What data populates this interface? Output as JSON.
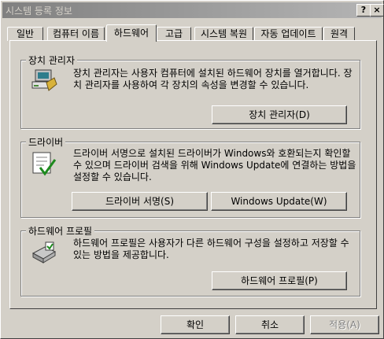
{
  "window": {
    "title": "시스템 등록 정보",
    "help_label": "?",
    "close_label": "×"
  },
  "tabs": [
    {
      "label": "일반"
    },
    {
      "label": "컴퓨터 이름"
    },
    {
      "label": "하드웨어"
    },
    {
      "label": "고급"
    },
    {
      "label": "시스템 복원"
    },
    {
      "label": "자동 업데이트"
    },
    {
      "label": "원격"
    }
  ],
  "active_tab": "하드웨어",
  "device_manager": {
    "title": "장치 관리자",
    "description": "장치 관리자는 사용자 컴퓨터에 설치된 하드웨어 장치를 열거합니다. 장치 관리자를 사용하여 각 장치의 속성을 변경할 수 있습니다.",
    "button_label": "장치 관리자(D)",
    "icon": "device-manager-icon"
  },
  "drivers": {
    "title": "드라이버",
    "description": "드라이버 서명으로 설치된 드라이버가 Windows와 호환되는지 확인할 수 있으며 드라이버 검색을 위해 Windows Update에 연결하는 방법을 설정할 수 있습니다.",
    "signing_button_label": "드라이버 서명(S)",
    "update_button_label": "Windows Update(W)",
    "icon": "driver-checklist-icon"
  },
  "hardware_profiles": {
    "title": "하드웨어 프로필",
    "description": "하드웨어 프로필은 사용자가 다른 하드웨어 구성을 설정하고 저장할 수 있는 방법을 제공합니다.",
    "button_label": "하드웨어 프로필(P)",
    "icon": "hardware-profile-icon"
  },
  "footer": {
    "ok_label": "확인",
    "cancel_label": "취소",
    "apply_label": "적용(A)"
  },
  "colors": {
    "face": "#d4d0c8",
    "title_start": "#808080",
    "title_end": "#b5b5b5",
    "shadow": "#808080",
    "highlight": "#ffffff"
  }
}
